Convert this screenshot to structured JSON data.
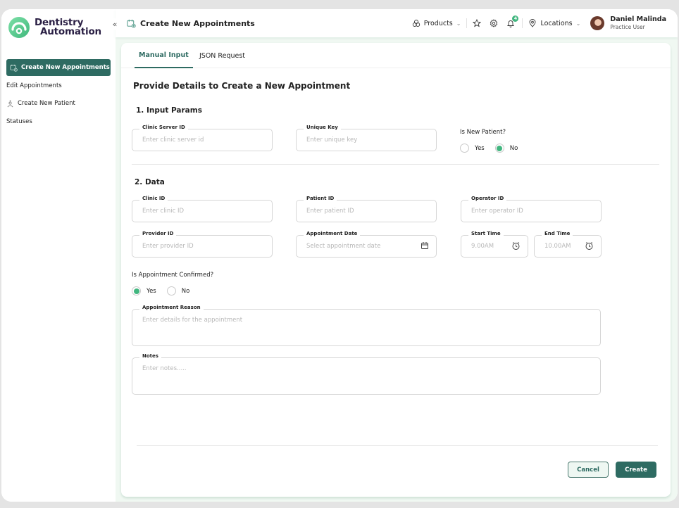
{
  "app": {
    "brand_line1": "Dentistry",
    "brand_line2": "Automation",
    "collapse_glyph": "«"
  },
  "sidebar": {
    "items": [
      {
        "label": "Create New Appointments",
        "icon": "calendar-add-icon",
        "active": true
      },
      {
        "label": "Edit Appointments",
        "icon": null,
        "active": false
      },
      {
        "label": "Create New Patient",
        "icon": "patient-add-icon",
        "active": false
      },
      {
        "label": "Statuses",
        "icon": null,
        "active": false
      }
    ]
  },
  "header": {
    "title": "Create New Appointments",
    "products_label": "Products",
    "locations_label": "Locations",
    "notification_count": "4",
    "user_name": "Daniel Malinda",
    "user_role": "Practice User"
  },
  "tabs": [
    {
      "label": "Manual Input",
      "active": true
    },
    {
      "label": "JSON Request",
      "active": false
    }
  ],
  "form": {
    "title": "Provide Details to Create a New Appointment",
    "section1_title": "1. Input Params",
    "section2_title": "2. Data",
    "clinic_server_id": {
      "label": "Clinic Server ID",
      "placeholder": "Enter clinic server id",
      "value": ""
    },
    "unique_key": {
      "label": "Unique Key",
      "placeholder": "Enter unique key",
      "value": ""
    },
    "is_new_patient": {
      "label": "Is New Patient?",
      "options": [
        "Yes",
        "No"
      ],
      "selected": "No"
    },
    "clinic_id": {
      "label": "Clinic ID",
      "placeholder": "Enter clinic ID",
      "value": ""
    },
    "patient_id": {
      "label": "Patient ID",
      "placeholder": "Enter patient ID",
      "value": ""
    },
    "operator_id": {
      "label": "Operator ID",
      "placeholder": "Enter operator ID",
      "value": ""
    },
    "provider_id": {
      "label": "Provider ID",
      "placeholder": "Enter provider ID",
      "value": ""
    },
    "appointment_date": {
      "label": "Appointment Date",
      "placeholder": "Select appointment date",
      "value": ""
    },
    "start_time": {
      "label": "Start Time",
      "placeholder": "9.00AM",
      "value": ""
    },
    "end_time": {
      "label": "End Time",
      "placeholder": "10.00AM",
      "value": ""
    },
    "is_confirmed": {
      "label": "Is Appointment Confirmed?",
      "options": [
        "Yes",
        "No"
      ],
      "selected": "Yes"
    },
    "appointment_reason": {
      "label": "Appointment Reason",
      "placeholder": "Enter details for the appointment",
      "value": ""
    },
    "notes": {
      "label": "Notes",
      "placeholder": "Enter notes.....",
      "value": ""
    }
  },
  "actions": {
    "cancel_label": "Cancel",
    "create_label": "Create"
  },
  "colors": {
    "primary": "#2e6b62",
    "accent": "#41b67f",
    "background": "#f0f8f2"
  }
}
